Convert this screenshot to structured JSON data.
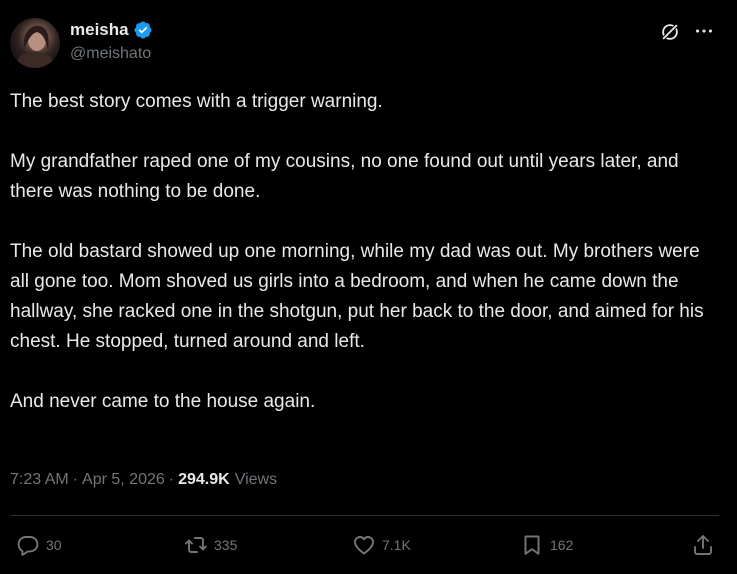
{
  "author": {
    "display_name": "meisha",
    "handle": "@meishato",
    "verified": true
  },
  "tweet": {
    "text": "The best story comes with a trigger warning.\n\nMy grandfather raped one of my cousins, no one found out until years later, and there was nothing to be done.\n\nThe old bastard showed up one morning, while my dad was out. My brothers were all gone too. Mom shoved us girls into a bedroom, and when he came down the hallway, she racked one in the shotgun, put her back to the door, and aimed for his chest. He stopped, turned around and left.\n\nAnd never came to the house again."
  },
  "meta": {
    "time": "7:23 AM",
    "separator": "·",
    "date": "Apr 5, 2026",
    "views_count": "294.9K",
    "views_label": "Views"
  },
  "actions": {
    "replies": "30",
    "reposts": "335",
    "likes": "7.1K",
    "bookmarks": "162"
  },
  "colors": {
    "background": "#000000",
    "text_primary": "#e7e9ea",
    "text_secondary": "#71767b",
    "verified": "#1d9bf0",
    "divider": "#2f3336"
  },
  "icons": {
    "verified": "verified-badge-icon",
    "grok": "grok-icon",
    "more": "more-options-icon",
    "reply": "reply-icon",
    "repost": "repost-icon",
    "like": "like-heart-icon",
    "bookmark": "bookmark-icon",
    "share": "share-icon"
  }
}
